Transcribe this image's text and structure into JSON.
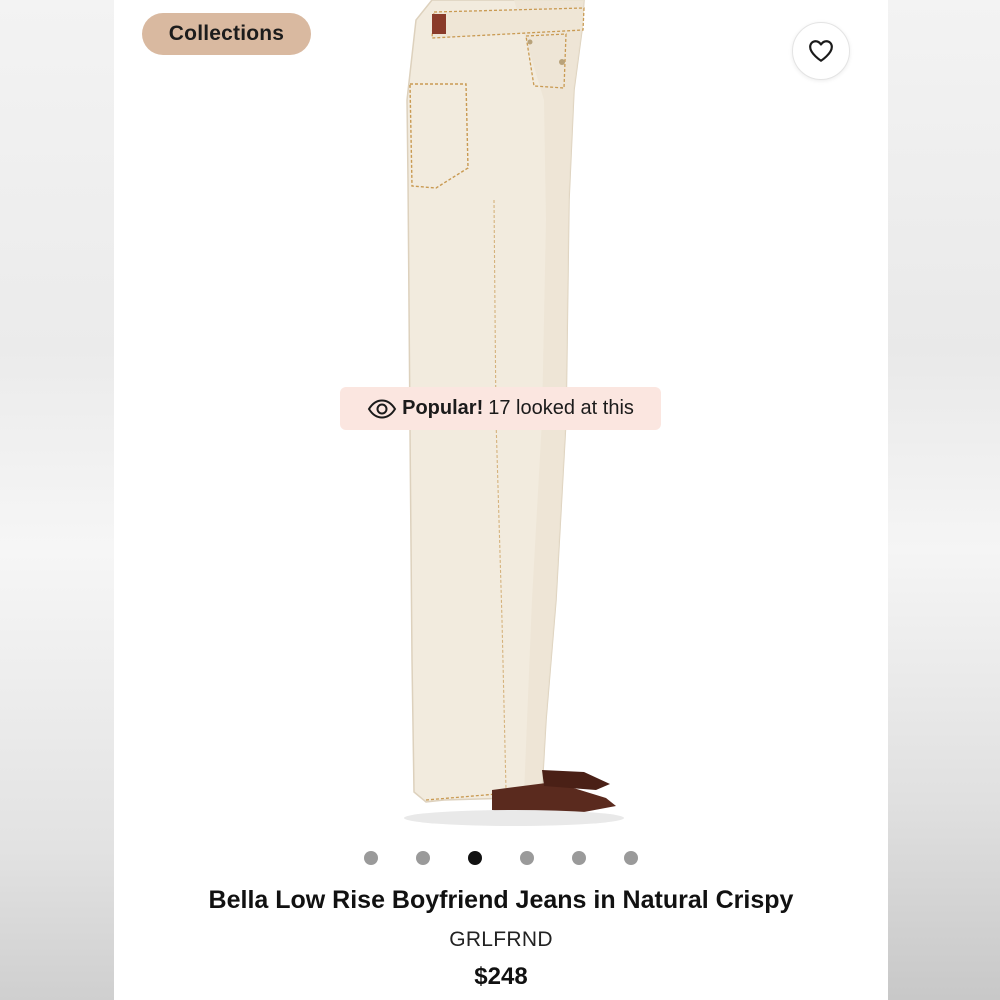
{
  "header": {
    "collections_label": "Collections",
    "favorite_icon": "heart-outline-icon"
  },
  "badge": {
    "icon": "eye-icon",
    "strong": "Popular!",
    "text": "17 looked at this"
  },
  "carousel": {
    "count": 6,
    "active_index": 2
  },
  "product": {
    "title": "Bella Low Rise Boyfriend Jeans in Natural Crispy",
    "brand": "GRLFRND",
    "price": "$248"
  },
  "colors": {
    "chip": "#d9b9a0",
    "badge": "#fbe6e0",
    "jeans": "#f2ebde",
    "stitch": "#c99a52",
    "shoe": "#5a2a1e"
  }
}
